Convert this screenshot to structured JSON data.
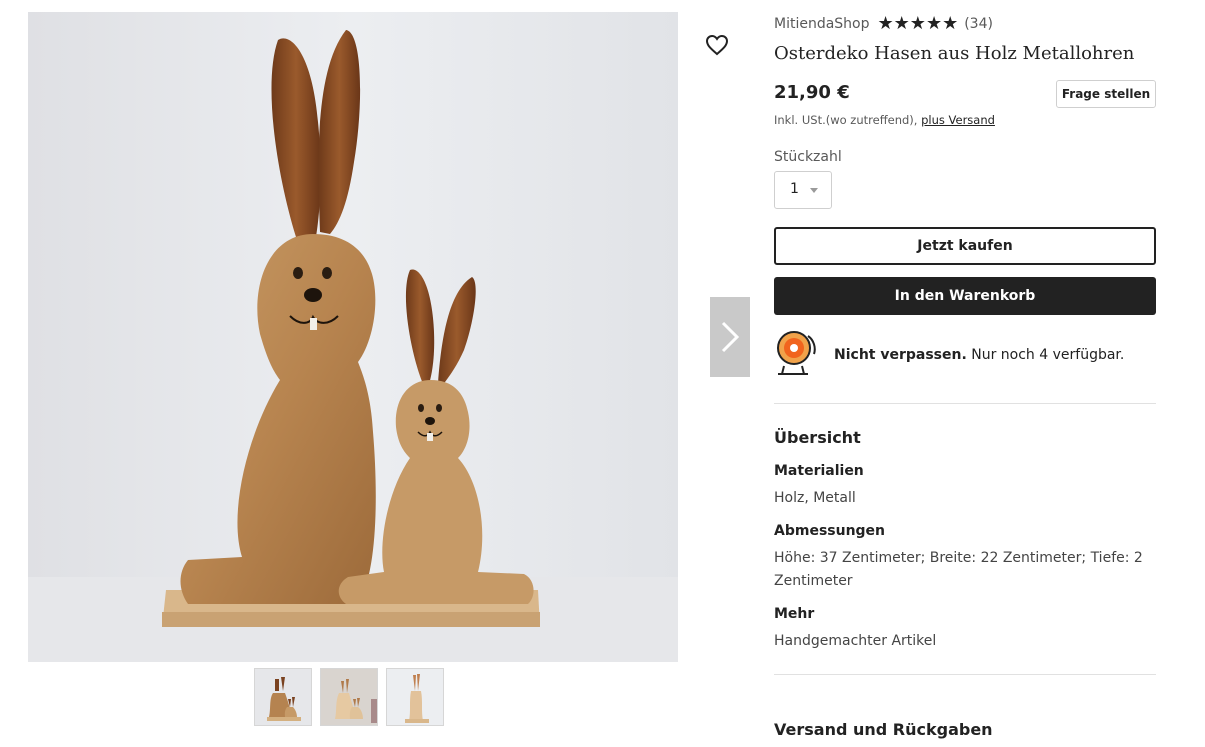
{
  "listing": {
    "shop_name": "MitiendaShop",
    "rating_stars": 5,
    "review_count": "(34)",
    "title": "Osterdeko Hasen aus Holz Metallohren",
    "price": "21,90 €",
    "ask_button": "Frage stellen",
    "tax_note": "Inkl. USt.(wo zutreffend),",
    "shipping_link": "plus Versand"
  },
  "purchase": {
    "quantity_label": "Stückzahl",
    "quantity_value": "1",
    "buy_now": "Jetzt kaufen",
    "add_to_cart": "In den Warenkorb",
    "scarcity_strong": "Nicht verpassen.",
    "scarcity_rest": " Nur noch 4 verfügbar."
  },
  "overview": {
    "heading": "Übersicht",
    "specs": [
      {
        "title": "Materialien",
        "value": "Holz, Metall"
      },
      {
        "title": "Abmessungen",
        "value": "Höhe: 37 Zentimeter; Breite: 22 Zentimeter; Tiefe: 2 Zentimeter"
      },
      {
        "title": "Mehr",
        "value": "Handgemachter Artikel"
      }
    ]
  },
  "shipping": {
    "heading": "Versand und Rückgaben"
  },
  "icons": {
    "favorite": "heart-icon",
    "next": "chevron-right-icon",
    "scarcity": "alarm-bell-icon",
    "rating": "star-icon"
  },
  "colors": {
    "cart_button": "#222222",
    "alarm_accent": "#f1641e"
  }
}
